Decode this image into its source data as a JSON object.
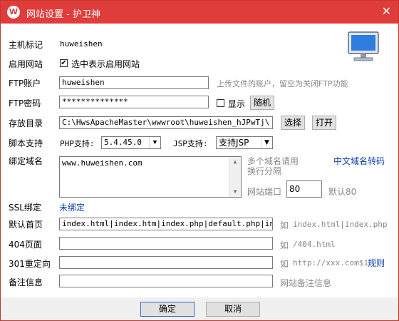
{
  "window": {
    "title": "网站设置 - 护卫神",
    "logo_letter": "W",
    "close_glyph": "✕"
  },
  "host": {
    "label": "主机标记",
    "value": "huweishen"
  },
  "enable": {
    "label": "启用网站",
    "checked": true,
    "check_text": "选中表示启用网站"
  },
  "ftp_account": {
    "label": "FTP账户",
    "value": "huweishen",
    "hint": "上传文件的账户，留空为关闭FTP功能"
  },
  "ftp_password": {
    "label": "FTP密码",
    "value": "**************",
    "show_label": "显示",
    "random_button": "随机",
    "show_checked": false
  },
  "dir": {
    "label": "存放目录",
    "value": "C:\\HwsApacheMaster\\wwwroot\\huweishen_hJPwTj\\",
    "select_button": "选择",
    "open_button": "打开"
  },
  "script": {
    "label": "脚本支持",
    "php_label": "PHP支持:",
    "php_value": "5.4.45.0",
    "jsp_label": "JSP支持:",
    "jsp_value": "支持JSP"
  },
  "domain": {
    "label": "绑定域名",
    "value": "www.huweishen.com",
    "hint_line1": "多个域名请用",
    "hint_line2": "换行分隔",
    "convert_link": "中文域名转码",
    "port_label": "网站端口",
    "port_value": "80",
    "port_default": "默认80"
  },
  "ssl": {
    "label": "SSL绑定",
    "link": "未绑定"
  },
  "index": {
    "label": "默认首页",
    "value": "index.html|index.htm|index.php|default.php|index.jsp",
    "hint_prefix": "如",
    "hint_value": "index.html|index.php"
  },
  "page404": {
    "label": "404页面",
    "value": "",
    "hint_prefix": "如",
    "hint_value": "/404.html"
  },
  "redirect": {
    "label": "301重定向",
    "value": "",
    "hint_prefix": "如",
    "hint_value": "http://xxx.com$1",
    "rule_link": "规则"
  },
  "note": {
    "label": "备注信息",
    "value": "",
    "hint": "网站备注信息"
  },
  "footer": {
    "ok": "确定",
    "cancel": "取消"
  }
}
